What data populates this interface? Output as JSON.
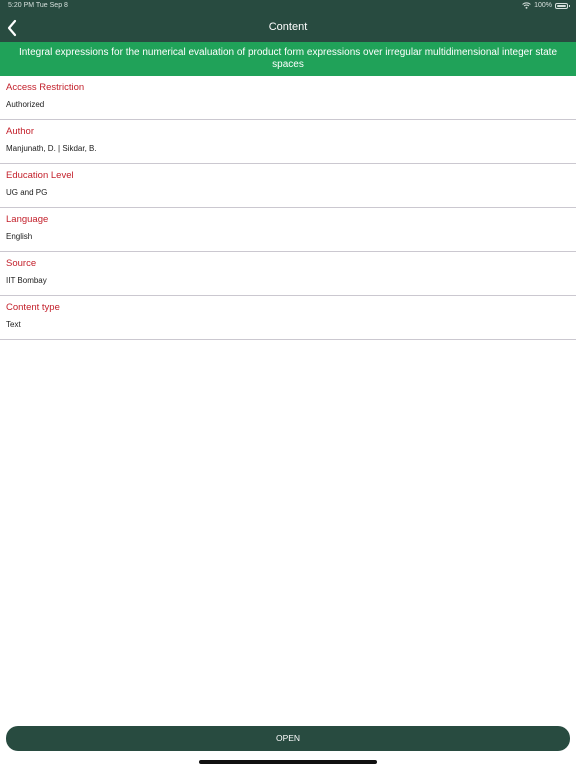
{
  "status_bar": {
    "time": "5:20 PM  Tue Sep 8",
    "battery": "100%",
    "wifi_icon": "wifi-icon",
    "battery_icon": "battery-icon"
  },
  "nav": {
    "title": "Content",
    "back_icon": "chevron-left-icon"
  },
  "banner": {
    "title": "Integral expressions for the numerical evaluation of product form expressions over irregular multidimensional integer state spaces"
  },
  "details": [
    {
      "label": "Access Restriction",
      "value": "Authorized"
    },
    {
      "label": "Author",
      "value": "Manjunath, D. | Sikdar, B."
    },
    {
      "label": "Education Level",
      "value": "UG and PG"
    },
    {
      "label": "Language",
      "value": "English"
    },
    {
      "label": "Source",
      "value": "IIT Bombay"
    },
    {
      "label": "Content type",
      "value": "Text"
    }
  ],
  "actions": {
    "open_label": "OPEN"
  },
  "colors": {
    "header": "#284b40",
    "banner": "#20a259",
    "label": "#c3202b",
    "divider": "#cbc8d0"
  }
}
